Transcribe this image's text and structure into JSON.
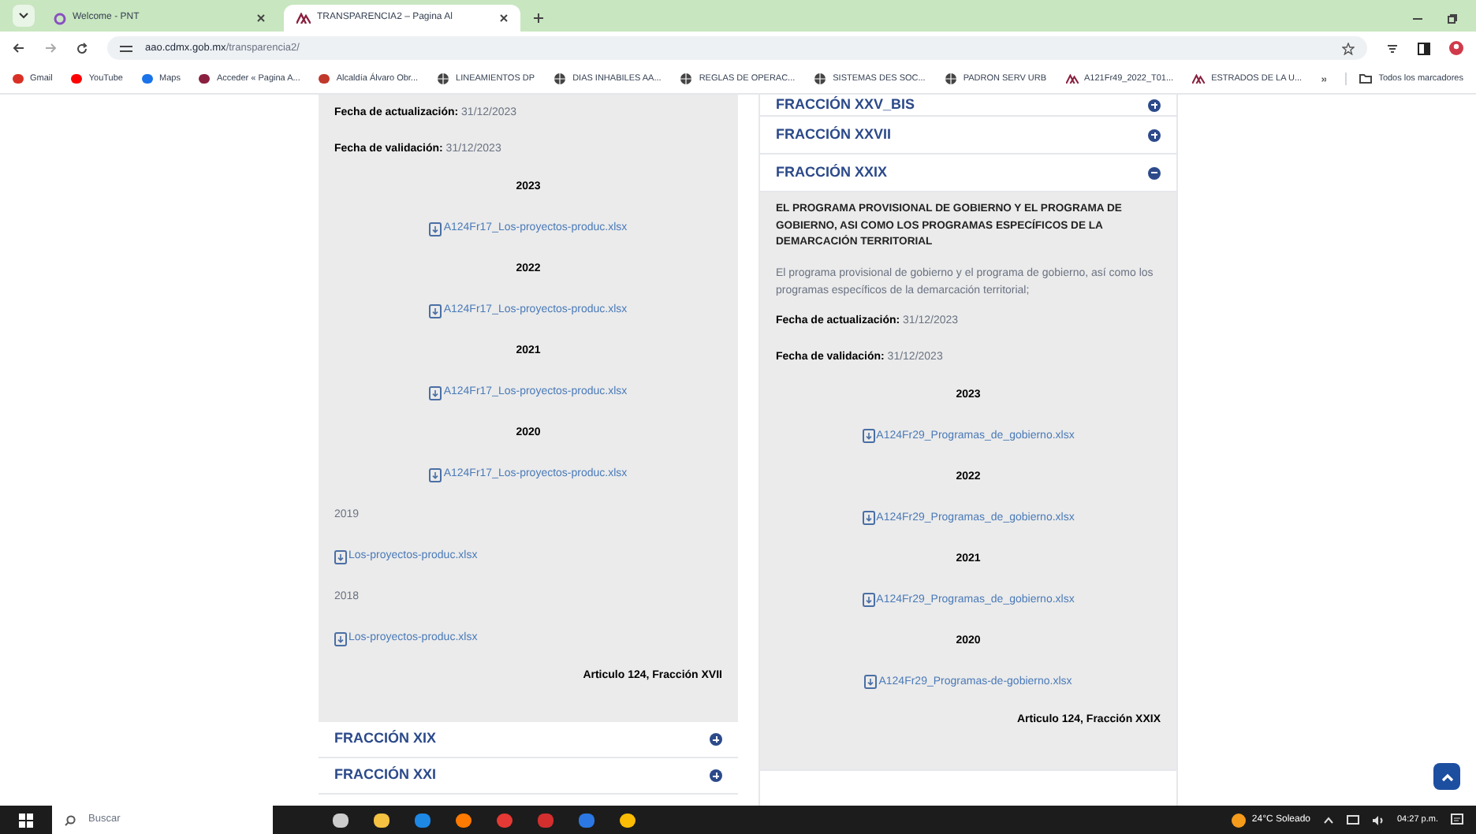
{
  "browser": {
    "tabs": [
      {
        "title": "Welcome - PNT",
        "selected": false
      },
      {
        "title": "TRANSPARENCIA2 – Pagina Al",
        "selected": true
      }
    ],
    "address": {
      "host": "aao.cdmx.gob.mx",
      "path": "/transparencia2/"
    },
    "bookmarks": [
      "Gmail",
      "YouTube",
      "Maps",
      "Acceder « Pagina A...",
      "Alcaldía Álvaro Obr...",
      "LINEAMIENTOS DP",
      "DIAS INHABILES AA...",
      "REGLAS DE OPERAC...",
      "SISTEMAS DES SOC...",
      "PADRON SERV URB",
      "A121Fr49_2022_T01...",
      "ESTRADOS DE LA U..."
    ],
    "all_bookmarks": "Todos los marcadores"
  },
  "left_column": {
    "panel": {
      "updated_label": "Fecha de actualización:",
      "updated": "31/12/2023",
      "validated_label": "Fecha de validación:",
      "validated": "31/12/2023",
      "sections": [
        {
          "kind": "centered",
          "year": "2023",
          "file": "A124Fr17_Los-proyectos-produc.xlsx"
        },
        {
          "kind": "centered",
          "year": "2022",
          "file": "A124Fr17_Los-proyectos-produc.xlsx"
        },
        {
          "kind": "centered",
          "year": "2021",
          "file": "A124Fr17_Los-proyectos-produc.xlsx"
        },
        {
          "kind": "centered",
          "year": "2020",
          "file": "A124Fr17_Los-proyectos-produc.xlsx"
        },
        {
          "kind": "plain",
          "year": "2019",
          "file": "Los-proyectos-produc.xlsx"
        },
        {
          "kind": "plain",
          "year": "2018",
          "file": "Los-proyectos-produc.xlsx"
        }
      ],
      "footer": "Articulo 124, Fracción XVII"
    },
    "items": [
      {
        "label": "FRACCIÓN XIX",
        "expanded": false
      },
      {
        "label": "FRACCIÓN XXI",
        "expanded": false
      }
    ]
  },
  "right_column": {
    "items": [
      {
        "label": "FRACCIÓN XXV_BIS",
        "expanded": false
      },
      {
        "label": "FRACCIÓN XXVII",
        "expanded": false
      },
      {
        "label": "FRACCIÓN XXIX",
        "expanded": true
      }
    ],
    "panel": {
      "heading": "EL PROGRAMA PROVISIONAL DE GOBIERNO Y EL PROGRAMA DE GOBIERNO, ASI COMO LOS PROGRAMAS ESPECÍFICOS DE LA DEMARCACIÓN TERRITORIAL",
      "description": "El programa provisional de gobierno y el programa de gobierno, así como los programas específicos de la demarcación territorial;",
      "updated_label": "Fecha de actualización:",
      "updated": "31/12/2023",
      "validated_label": "Fecha de validación:",
      "validated": "31/12/2023",
      "sections": [
        {
          "kind": "centered",
          "year": "2023",
          "file": "A124Fr29_Programas_de_gobierno.xlsx"
        },
        {
          "kind": "centered",
          "year": "2022",
          "file": "A124Fr29_Programas_de_gobierno.xlsx"
        },
        {
          "kind": "centered",
          "year": "2021",
          "file": "A124Fr29_Programas_de_gobierno.xlsx"
        },
        {
          "kind": "centered",
          "year": "2020",
          "file": "A124Fr29_Programas-de-gobierno.xlsx"
        }
      ],
      "footer": "Articulo 124, Fracción XXIX"
    }
  },
  "taskbar": {
    "search_placeholder": "Buscar",
    "weather": "24°C  Soleado",
    "time": "04:27 p.m."
  }
}
